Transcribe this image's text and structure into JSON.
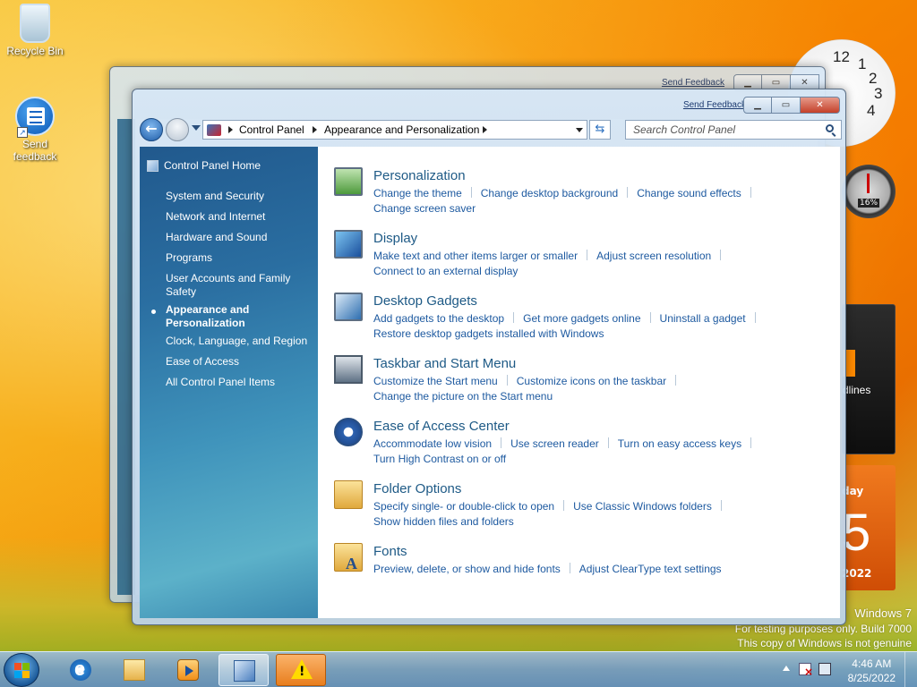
{
  "desktop": {
    "icons": [
      {
        "label": "Recycle Bin",
        "icon": "recycle-bin-icon"
      },
      {
        "label": "Send feedback",
        "icon": "feedback-icon"
      }
    ],
    "clock_numbers": [
      "12",
      "1",
      "2",
      "3",
      "4"
    ],
    "cpu_meter": {
      "value": "16%"
    },
    "feed_gadget": {
      "text": "dlines"
    },
    "calendar": {
      "day": "day",
      "date": "5",
      "year": "2022"
    },
    "watermark": {
      "line1": "Windows 7",
      "line2": "For testing purposes only. Build 7000",
      "line3": "This copy of Windows is not genuine"
    }
  },
  "window_back": {
    "send_feedback": "Send Feedback"
  },
  "window": {
    "send_feedback": "Send Feedback",
    "buttons": {
      "minimize": "▁",
      "maximize": "▭",
      "close": "✕"
    },
    "breadcrumb": [
      "Control Panel",
      "Appearance and Personalization"
    ],
    "search_placeholder": "Search Control Panel",
    "sidebar": {
      "home": "Control Panel Home",
      "items": [
        {
          "label": "System and Security",
          "active": false
        },
        {
          "label": "Network and Internet",
          "active": false
        },
        {
          "label": "Hardware and Sound",
          "active": false
        },
        {
          "label": "Programs",
          "active": false
        },
        {
          "label": "User Accounts and Family Safety",
          "active": false
        },
        {
          "label": "Appearance and Personalization",
          "active": true
        },
        {
          "label": "Clock, Language, and Region",
          "active": false
        },
        {
          "label": "Ease of Access",
          "active": false
        },
        {
          "label": "All Control Panel Items",
          "active": false
        }
      ]
    },
    "categories": [
      {
        "title": "Personalization",
        "icon": "personalization-icon",
        "links": [
          "Change the theme",
          "Change desktop background",
          "Change sound effects",
          "Change screen saver"
        ]
      },
      {
        "title": "Display",
        "icon": "display-icon",
        "links": [
          "Make text and other items larger or smaller",
          "Adjust screen resolution",
          "Connect to an external display"
        ]
      },
      {
        "title": "Desktop Gadgets",
        "icon": "gadgets-icon",
        "links": [
          "Add gadgets to the desktop",
          "Get more gadgets online",
          "Uninstall a gadget",
          "Restore desktop gadgets installed with Windows"
        ]
      },
      {
        "title": "Taskbar and Start Menu",
        "icon": "taskbar-icon",
        "links": [
          "Customize the Start menu",
          "Customize icons on the taskbar",
          "Change the picture on the Start menu"
        ]
      },
      {
        "title": "Ease of Access Center",
        "icon": "ease-of-access-icon",
        "links": [
          "Accommodate low vision",
          "Use screen reader",
          "Turn on easy access keys",
          "Turn High Contrast on or off"
        ]
      },
      {
        "title": "Folder Options",
        "icon": "folder-options-icon",
        "links": [
          "Specify single- or double-click to open",
          "Use Classic Windows folders",
          "Show hidden files and folders"
        ]
      },
      {
        "title": "Fonts",
        "icon": "fonts-icon",
        "links": [
          "Preview, delete, or show and hide fonts",
          "Adjust ClearType text settings"
        ]
      }
    ]
  },
  "taskbar": {
    "apps": [
      {
        "name": "internet-explorer",
        "icon": "ie-icon",
        "active": false
      },
      {
        "name": "windows-explorer",
        "icon": "explorer-icon",
        "active": false
      },
      {
        "name": "media-player",
        "icon": "media-player-icon",
        "active": false
      },
      {
        "name": "control-panel",
        "icon": "control-panel-icon",
        "active": true
      },
      {
        "name": "warning",
        "icon": "warning-icon",
        "active": false
      }
    ],
    "time": "4:46 AM",
    "date": "8/25/2022"
  }
}
